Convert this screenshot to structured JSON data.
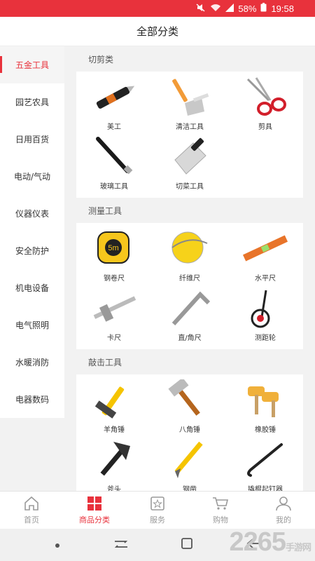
{
  "status_bar": {
    "battery": "58%",
    "time": "19:58"
  },
  "header": {
    "title": "全部分类"
  },
  "sidebar": {
    "items": [
      {
        "label": "五金工具",
        "active": true
      },
      {
        "label": "园艺农具"
      },
      {
        "label": "日用百货"
      },
      {
        "label": "电动/气动"
      },
      {
        "label": "仪器仪表"
      },
      {
        "label": "安全防护"
      },
      {
        "label": "机电设备"
      },
      {
        "label": "电气照明"
      },
      {
        "label": "水暖消防"
      },
      {
        "label": "电器数码"
      }
    ]
  },
  "sections": [
    {
      "title": "切剪类",
      "items": [
        {
          "label": "美工",
          "icon": "utility-knife-icon"
        },
        {
          "label": "清洁工具",
          "icon": "scraper-icon"
        },
        {
          "label": "剪具",
          "icon": "scissors-icon"
        },
        {
          "label": "玻璃工具",
          "icon": "glass-cutter-icon"
        },
        {
          "label": "切菜工具",
          "icon": "cleaver-icon"
        }
      ]
    },
    {
      "title": "测量工具",
      "items": [
        {
          "label": "钢卷尺",
          "icon": "tape-measure-icon"
        },
        {
          "label": "纤维尺",
          "icon": "fiber-tape-icon"
        },
        {
          "label": "水平尺",
          "icon": "level-icon"
        },
        {
          "label": "卡尺",
          "icon": "caliper-icon"
        },
        {
          "label": "直/角尺",
          "icon": "square-ruler-icon"
        },
        {
          "label": "测距轮",
          "icon": "measuring-wheel-icon"
        }
      ]
    },
    {
      "title": "敲击工具",
      "items": [
        {
          "label": "羊角锤",
          "icon": "claw-hammer-icon"
        },
        {
          "label": "八角锤",
          "icon": "sledge-hammer-icon"
        },
        {
          "label": "橡胶锤",
          "icon": "rubber-mallet-icon"
        },
        {
          "label": "斧头",
          "icon": "axe-icon"
        },
        {
          "label": "钢凿",
          "icon": "chisel-icon"
        },
        {
          "label": "撬棍起钉器",
          "icon": "crowbar-icon"
        }
      ]
    }
  ],
  "bottom_nav": {
    "items": [
      {
        "label": "首页",
        "icon": "home-icon"
      },
      {
        "label": "商品分类",
        "icon": "category-icon",
        "active": true
      },
      {
        "label": "服务",
        "icon": "service-icon"
      },
      {
        "label": "购物",
        "icon": "cart-icon"
      },
      {
        "label": "我的",
        "icon": "user-icon"
      }
    ]
  },
  "watermark": {
    "number": "2265",
    "suffix": "手游网"
  },
  "colors": {
    "accent": "#e8323c",
    "muted": "#9a9a9a"
  }
}
